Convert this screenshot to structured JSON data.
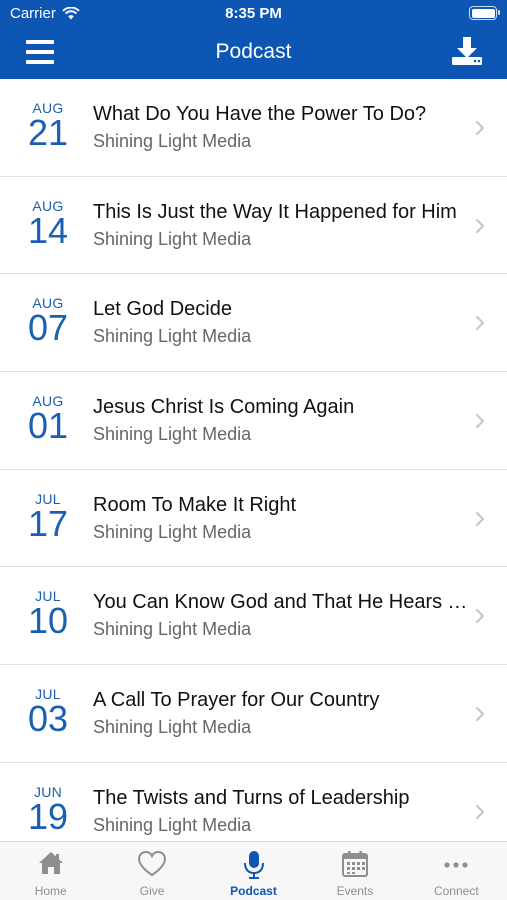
{
  "status": {
    "carrier": "Carrier",
    "time": "8:35 PM"
  },
  "nav": {
    "title": "Podcast"
  },
  "episodes": [
    {
      "month": "AUG",
      "day": "21",
      "title": "What Do You Have the Power To Do?",
      "subtitle": "Shining Light Media"
    },
    {
      "month": "AUG",
      "day": "14",
      "title": "This Is Just the Way It Happened for Him",
      "subtitle": "Shining Light Media"
    },
    {
      "month": "AUG",
      "day": "07",
      "title": "Let God Decide",
      "subtitle": "Shining Light Media"
    },
    {
      "month": "AUG",
      "day": "01",
      "title": "Jesus Christ Is Coming Again",
      "subtitle": "Shining Light Media"
    },
    {
      "month": "JUL",
      "day": "17",
      "title": "Room To Make It Right",
      "subtitle": "Shining Light Media"
    },
    {
      "month": "JUL",
      "day": "10",
      "title": "You Can Know God and That He Hears You",
      "subtitle": "Shining Light Media"
    },
    {
      "month": "JUL",
      "day": "03",
      "title": "A Call To Prayer for Our Country",
      "subtitle": "Shining Light Media"
    },
    {
      "month": "JUN",
      "day": "19",
      "title": "The Twists and Turns of Leadership",
      "subtitle": "Shining Light Media"
    }
  ],
  "tabs": [
    {
      "label": "Home",
      "icon": "home-icon",
      "active": false
    },
    {
      "label": "Give",
      "icon": "heart-icon",
      "active": false
    },
    {
      "label": "Podcast",
      "icon": "microphone-icon",
      "active": true
    },
    {
      "label": "Events",
      "icon": "calendar-icon",
      "active": false
    },
    {
      "label": "Connect",
      "icon": "more-dots-icon",
      "active": false
    }
  ],
  "colors": {
    "brand": "#0d56b3",
    "date_accent": "#1a5fb4",
    "tab_inactive": "#8e8e8e"
  }
}
